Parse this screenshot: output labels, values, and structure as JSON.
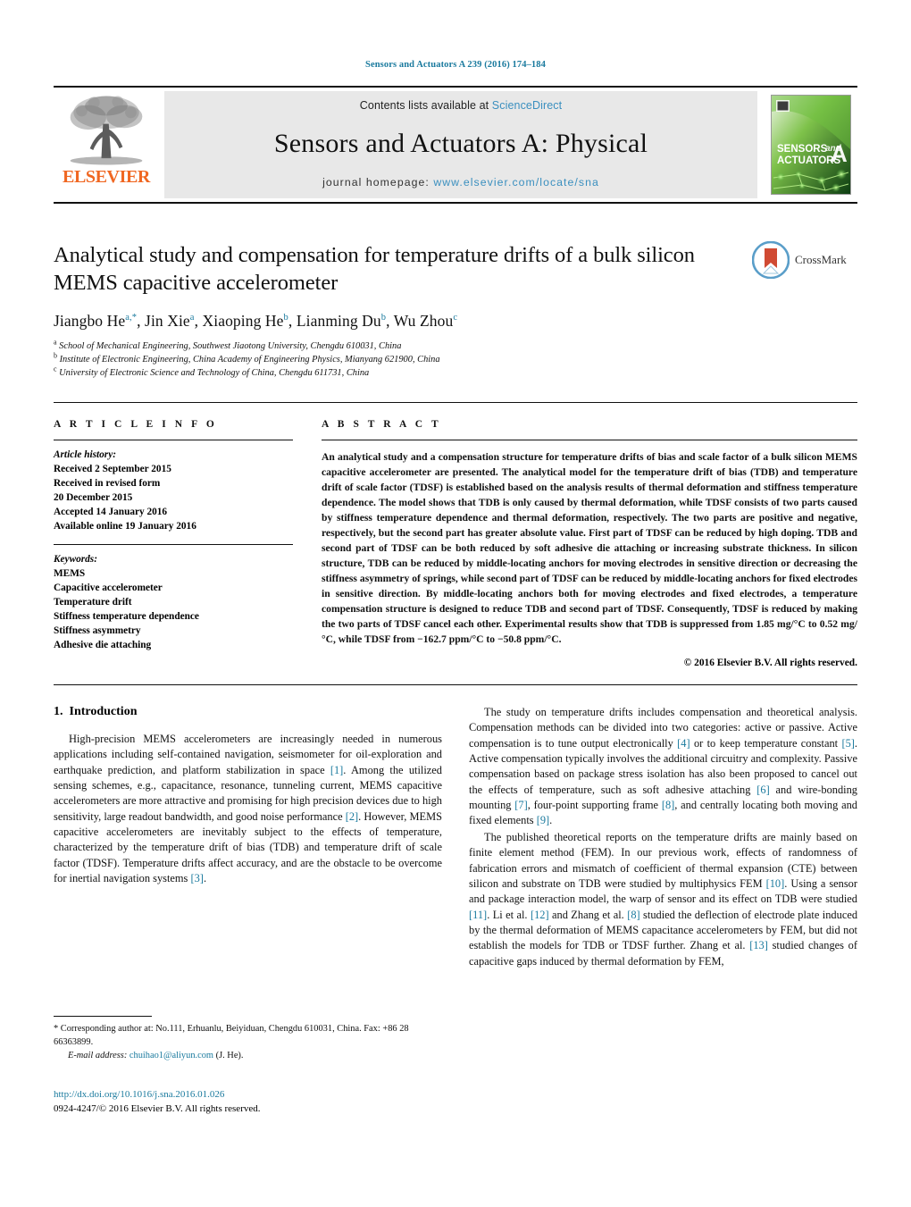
{
  "running_head": "Sensors and Actuators A 239 (2016) 174–184",
  "masthead": {
    "contents_prefix": "Contents lists available at ",
    "sciencedirect": "ScienceDirect",
    "journal_title": "Sensors and Actuators A: Physical",
    "homepage_prefix": "journal homepage: ",
    "homepage_url": "www.elsevier.com/locate/sna",
    "publisher": "ELSEVIER",
    "cover_line1": "SENSORS",
    "cover_and": "and",
    "cover_line2": "ACTUATORS",
    "cover_letter": "A",
    "colors": {
      "link": "#3a8fbf",
      "running_head": "#1a7a9e",
      "elsevier_orange": "#f06722",
      "band_bg": "#e8e8e8"
    }
  },
  "article": {
    "title": "Analytical study and compensation for temperature drifts of a bulk silicon MEMS capacitive accelerometer",
    "crossmark_label": "CrossMark",
    "authors": [
      {
        "name": "Jiangbo He",
        "sup": "a,*"
      },
      {
        "name": "Jin Xie",
        "sup": "a"
      },
      {
        "name": "Xiaoping He",
        "sup": "b"
      },
      {
        "name": "Lianming Du",
        "sup": "b"
      },
      {
        "name": "Wu Zhou",
        "sup": "c"
      }
    ],
    "affiliations": [
      {
        "mark": "a",
        "text": "School of Mechanical Engineering, Southwest Jiaotong University, Chengdu 610031, China"
      },
      {
        "mark": "b",
        "text": "Institute of Electronic Engineering, China Academy of Engineering Physics, Mianyang 621900, China"
      },
      {
        "mark": "c",
        "text": "University of Electronic Science and Technology of China, Chengdu 611731, China"
      }
    ]
  },
  "article_info": {
    "heading": "A R T I C L E   I N F O",
    "history_label": "Article history:",
    "history": [
      "Received 2 September 2015",
      "Received in revised form",
      "20 December 2015",
      "Accepted 14 January 2016",
      "Available online 19 January 2016"
    ],
    "keywords_label": "Keywords:",
    "keywords": [
      "MEMS",
      "Capacitive accelerometer",
      "Temperature drift",
      "Stiffness temperature dependence",
      "Stiffness asymmetry",
      "Adhesive die attaching"
    ]
  },
  "abstract": {
    "heading": "A B S T R A C T",
    "text": "An analytical study and a compensation structure for temperature drifts of bias and scale factor of a bulk silicon MEMS capacitive accelerometer are presented. The analytical model for the temperature drift of bias (TDB) and temperature drift of scale factor (TDSF) is established based on the analysis results of thermal deformation and stiffness temperature dependence. The model shows that TDB is only caused by thermal deformation, while TDSF consists of two parts caused by stiffness temperature dependence and thermal deformation, respectively. The two parts are positive and negative, respectively, but the second part has greater absolute value. First part of TDSF can be reduced by high doping. TDB and second part of TDSF can be both reduced by soft adhesive die attaching or increasing substrate thickness. In silicon structure, TDB can be reduced by middle-locating anchors for moving electrodes in sensitive direction or decreasing the stiffness asymmetry of springs, while second part of TDSF can be reduced by middle-locating anchors for fixed electrodes in sensitive direction. By middle-locating anchors both for moving electrodes and fixed electrodes, a temperature compensation structure is designed to reduce TDB and second part of TDSF. Consequently, TDSF is reduced by making the two parts of TDSF cancel each other. Experimental results show that TDB is suppressed from 1.85 mg/°C to 0.52 mg/°C, while TDSF from −162.7 ppm/°C to −50.8 ppm/°C.",
    "copyright": "© 2016 Elsevier B.V. All rights reserved."
  },
  "introduction": {
    "number": "1.",
    "heading": "Introduction",
    "left_paragraphs": [
      {
        "segments": [
          {
            "t": "High-precision MEMS accelerometers are increasingly needed in numerous applications including self-contained navigation, seismometer for oil-exploration and earthquake prediction, and platform stabilization in space "
          },
          {
            "t": "[1]",
            "ref": true
          },
          {
            "t": ". Among the utilized sensing schemes, e.g., capacitance, resonance, tunneling current, MEMS capacitive accelerometers are more attractive and promising for high precision devices due to high sensitivity, large readout bandwidth, and good noise performance "
          },
          {
            "t": "[2]",
            "ref": true
          },
          {
            "t": ". However, MEMS capacitive accelerometers are inevitably subject to the effects of temperature, characterized by the temperature drift of bias (TDB) and temperature drift of scale factor (TDSF). Temperature drifts affect accuracy, and are the obstacle to be overcome for inertial navigation systems "
          },
          {
            "t": "[3]",
            "ref": true
          },
          {
            "t": "."
          }
        ]
      }
    ],
    "right_paragraphs": [
      {
        "segments": [
          {
            "t": "The study on temperature drifts includes compensation and theoretical analysis. Compensation methods can be divided into two categories: active or passive. Active compensation is to tune output electronically "
          },
          {
            "t": "[4]",
            "ref": true
          },
          {
            "t": " or to keep temperature constant "
          },
          {
            "t": "[5]",
            "ref": true
          },
          {
            "t": ". Active compensation typically involves the additional circuitry and complexity. Passive compensation based on package stress isolation has also been proposed to cancel out the effects of temperature, such as soft adhesive attaching "
          },
          {
            "t": "[6]",
            "ref": true
          },
          {
            "t": " and wire-bonding mounting "
          },
          {
            "t": "[7]",
            "ref": true
          },
          {
            "t": ", four-point supporting frame "
          },
          {
            "t": "[8]",
            "ref": true
          },
          {
            "t": ", and centrally locating both moving and fixed elements "
          },
          {
            "t": "[9]",
            "ref": true
          },
          {
            "t": "."
          }
        ]
      },
      {
        "segments": [
          {
            "t": "The published theoretical reports on the temperature drifts are mainly based on finite element method (FEM). In our previous work, effects of randomness of fabrication errors and mismatch of coefficient of thermal expansion (CTE) between silicon and substrate on TDB were studied by multiphysics FEM "
          },
          {
            "t": "[10]",
            "ref": true
          },
          {
            "t": ". Using a sensor and package interaction model, the warp of sensor and its effect on TDB were studied "
          },
          {
            "t": "[11]",
            "ref": true
          },
          {
            "t": ". Li et al. "
          },
          {
            "t": "[12]",
            "ref": true
          },
          {
            "t": " and Zhang et al. "
          },
          {
            "t": "[8]",
            "ref": true
          },
          {
            "t": " studied the deflection of electrode plate induced by the thermal deformation of MEMS capacitance accelerometers by FEM, but did not establish the models for TDB or TDSF further. Zhang et al. "
          },
          {
            "t": "[13]",
            "ref": true
          },
          {
            "t": " studied changes of capacitive gaps induced by thermal deformation by FEM,"
          }
        ]
      }
    ]
  },
  "footnote": {
    "star": "*",
    "corresponding": " Corresponding author at: No.111, Erhuanlu, Beiyiduan, Chengdu 610031, China. Fax: +86 28 66363899.",
    "email_label": "E-mail address:",
    "email": "chuihao1@aliyun.com",
    "email_suffix": " (J. He)."
  },
  "imprint": {
    "doi": "http://dx.doi.org/10.1016/j.sna.2016.01.026",
    "issn_line": "0924-4247/© 2016 Elsevier B.V. All rights reserved."
  }
}
